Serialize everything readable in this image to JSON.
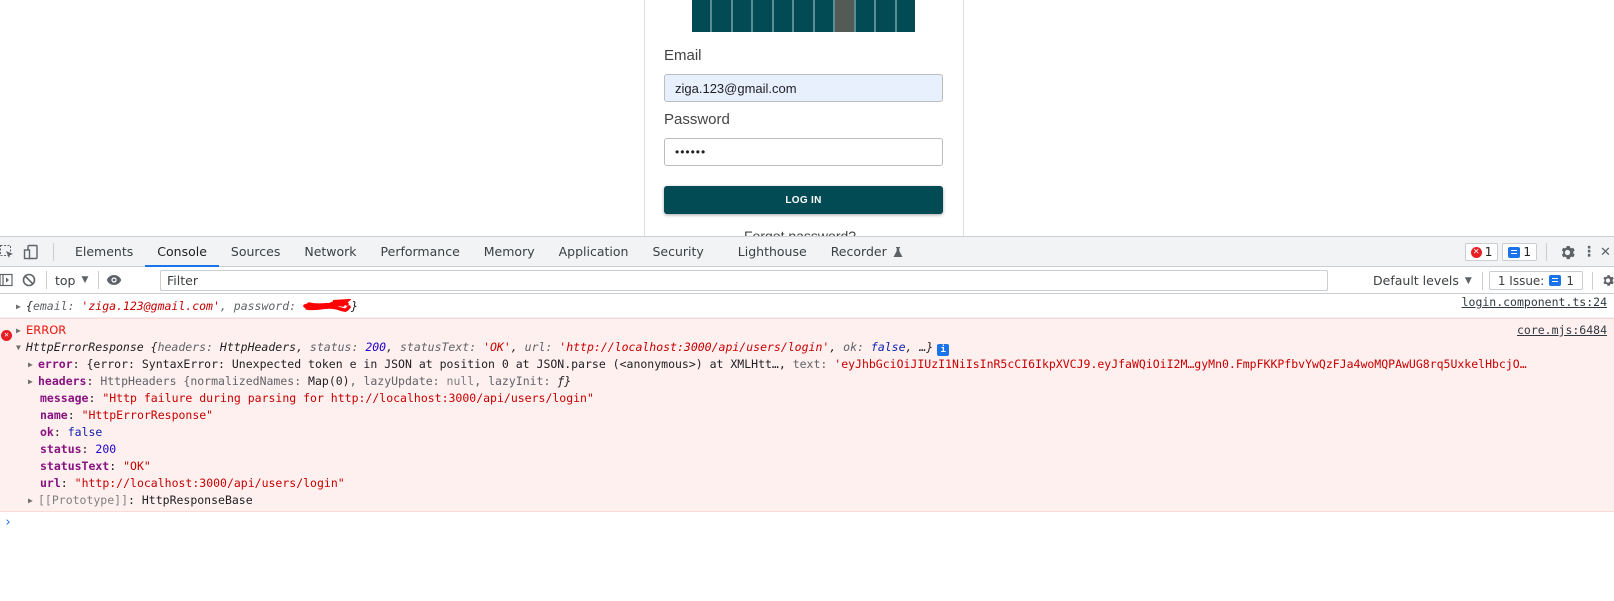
{
  "page": {
    "email_label": "Email",
    "email_value": "ziga.123@gmail.com",
    "password_label": "Password",
    "password_value": "••••••",
    "login_button": "LOG IN",
    "forgot_link": "Forgot password?",
    "brand_color": "#024b54"
  },
  "devtools": {
    "tabs": [
      {
        "label": "Elements",
        "active": false
      },
      {
        "label": "Console",
        "active": true
      },
      {
        "label": "Sources",
        "active": false
      },
      {
        "label": "Network",
        "active": false
      },
      {
        "label": "Performance",
        "active": false
      },
      {
        "label": "Memory",
        "active": false
      },
      {
        "label": "Application",
        "active": false
      },
      {
        "label": "Security",
        "active": false
      },
      {
        "label": "Lighthouse",
        "active": false
      },
      {
        "label": "Recorder",
        "active": false
      }
    ],
    "error_count": "1",
    "message_count": "1",
    "toolbar": {
      "context": "top",
      "filter_placeholder": "Filter",
      "levels": "Default levels",
      "issues_label": "1 Issue:",
      "issues_count": "1"
    }
  },
  "console": {
    "log": {
      "open": "{",
      "email_key": "email",
      "email_value": "'ziga.123@gmail.com'",
      "password_key": "password",
      "close": "}",
      "source": "login.component.ts:24"
    },
    "error": {
      "label": "ERROR",
      "source": "core.mjs:6484",
      "summary": {
        "type": "HttpErrorResponse",
        "headers_key": "headers",
        "headers_val": "HttpHeaders",
        "status_key": "status",
        "status_val": "200",
        "statusText_key": "statusText",
        "statusText_val": "'OK'",
        "url_key": "url",
        "url_val": "'http://localhost:3000/api/users/login'",
        "ok_key": "ok",
        "ok_val": "false",
        "ellipsis": "…}"
      },
      "props": {
        "error_key": "error",
        "error_val": "{error: SyntaxError: Unexpected token e in JSON at position 0 at JSON.parse (<anonymous>) at XMLHtt…, ",
        "error_text_key": "text",
        "error_text_val": "'eyJhbGciOiJIUzI1NiIsInR5cCI6IkpXVCJ9.eyJfaWQiOiI2M…gyMn0.FmpFKKPfbvYwQzFJa4woMQPAwUG8rq5UxkelHbcjO…",
        "headers_key": "headers",
        "headers_val_a": "HttpHeaders {normalizedNames: ",
        "headers_map": "Map(0)",
        "headers_val_b": ", lazyUpdate: ",
        "headers_null": "null",
        "headers_val_c": ", lazyInit: ",
        "headers_f": "ƒ}",
        "message_key": "message",
        "message_val": "\"Http failure during parsing for http://localhost:3000/api/users/login\"",
        "name_key": "name",
        "name_val": "\"HttpErrorResponse\"",
        "ok_key": "ok",
        "ok_val": "false",
        "status_key": "status",
        "status_val": "200",
        "statusText_key": "statusText",
        "statusText_val": "\"OK\"",
        "url_key": "url",
        "url_val": "\"http://localhost:3000/api/users/login\"",
        "proto_key": "[[Prototype]]",
        "proto_val": "HttpResponseBase"
      }
    },
    "prompt": "›"
  }
}
